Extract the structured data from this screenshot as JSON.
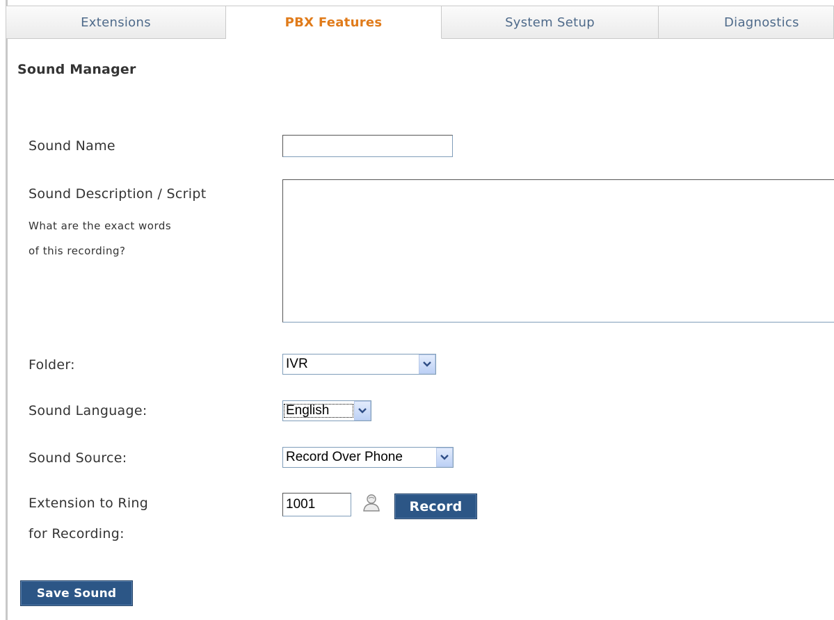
{
  "tabs": [
    {
      "label": "Extensions"
    },
    {
      "label": "PBX Features"
    },
    {
      "label": "System Setup"
    },
    {
      "label": "Diagnostics"
    }
  ],
  "active_tab": "PBX Features",
  "colors": {
    "active_tab": "#e07b1a",
    "tab_text": "#4e6a8a",
    "button_bg": "#2c5686"
  },
  "page": {
    "title": "Sound Manager"
  },
  "form": {
    "sound_name": {
      "label": "Sound Name",
      "value": ""
    },
    "description": {
      "label": "Sound Description / Script",
      "hint_line1": "What are the exact words",
      "hint_line2": "of this recording?",
      "value": ""
    },
    "folder": {
      "label": "Folder:",
      "selected": "IVR"
    },
    "language": {
      "label": "Sound Language:",
      "selected": "English"
    },
    "source": {
      "label": "Sound Source:",
      "selected": "Record Over Phone"
    },
    "extension": {
      "label_line1": "Extension to Ring",
      "label_line2": "for Recording:",
      "value": "1001",
      "picker_icon": "person-icon",
      "record_label": "Record"
    }
  },
  "save_label": "Save Sound"
}
